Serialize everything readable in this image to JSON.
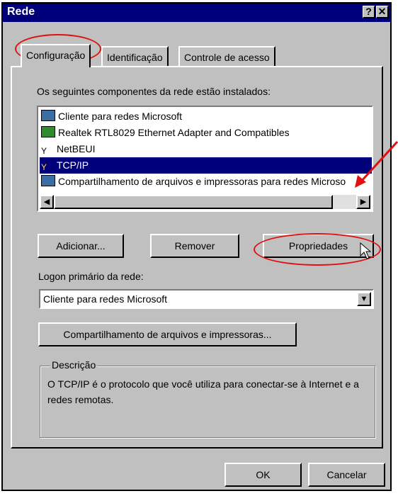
{
  "window": {
    "title": "Rede",
    "help_button": "?",
    "close_button": "✕"
  },
  "tabs": [
    {
      "label": "Configuração",
      "active": true
    },
    {
      "label": "Identificação",
      "active": false
    },
    {
      "label": "Controle de acesso",
      "active": false
    }
  ],
  "components": {
    "label": "Os seguintes componentes da rede estão instalados:",
    "items": [
      {
        "icon": "client-icon",
        "label": "Cliente para redes Microsoft",
        "selected": false
      },
      {
        "icon": "network-adapter-icon",
        "label": "Realtek RTL8029 Ethernet Adapter and Compatibles",
        "selected": false
      },
      {
        "icon": "protocol-icon",
        "label": "NetBEUI",
        "selected": false
      },
      {
        "icon": "protocol-icon",
        "label": "TCP/IP",
        "selected": true
      },
      {
        "icon": "service-icon",
        "label": "Compartilhamento de arquivos e impressoras para redes Microso",
        "selected": false
      }
    ]
  },
  "buttons": {
    "add": "Adicionar...",
    "remove": "Remover",
    "properties": "Propriedades"
  },
  "logon": {
    "label": "Logon primário da rede:",
    "value": "Cliente para redes Microsoft"
  },
  "sharing_button": "Compartilhamento de arquivos e impressoras...",
  "description": {
    "title": "Descrição",
    "text": "O TCP/IP é o protocolo que você utiliza para conectar-se à Internet e a redes remotas."
  },
  "footer": {
    "ok": "OK",
    "cancel": "Cancelar"
  },
  "colors": {
    "title_bar": "#00007b",
    "selection": "#00007b",
    "face": "#c0c0c0",
    "annotation": "#e01010"
  }
}
